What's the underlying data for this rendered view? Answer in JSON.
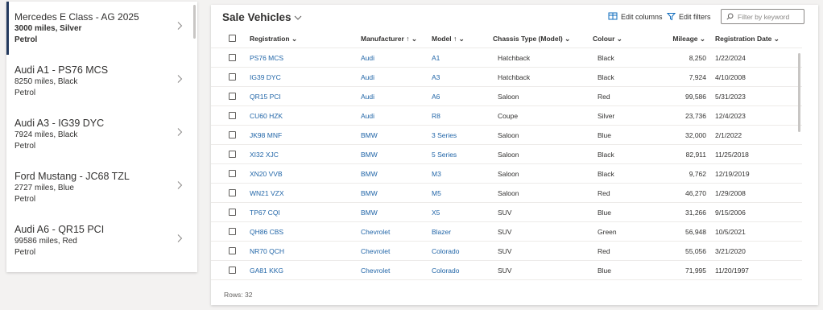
{
  "list": {
    "items": [
      {
        "title": "Mercedes E Class - AG 2025",
        "line1": "3000 miles, Silver",
        "line2": "Petrol",
        "selected": true
      },
      {
        "title": "Audi A1 - PS76 MCS",
        "line1": "8250 miles, Black",
        "line2": "Petrol",
        "selected": false
      },
      {
        "title": "Audi A3 - IG39 DYC",
        "line1": "7924 miles, Black",
        "line2": "Petrol",
        "selected": false
      },
      {
        "title": "Ford Mustang - JC68 TZL",
        "line1": "2727 miles, Blue",
        "line2": "Petrol",
        "selected": false
      },
      {
        "title": "Audi A6 - QR15 PCI",
        "line1": "99586 miles, Red",
        "line2": "Petrol",
        "selected": false
      }
    ]
  },
  "grid": {
    "title": "Sale Vehicles",
    "edit_columns_label": "Edit columns",
    "edit_filters_label": "Edit filters",
    "search_placeholder": "Filter by keyword",
    "columns": {
      "registration": "Registration",
      "manufacturer": "Manufacturer",
      "model": "Model",
      "chassis": "Chassis Type (Model)",
      "colour": "Colour",
      "mileage": "Mileage",
      "registration_date": "Registration Date"
    },
    "rows": [
      {
        "reg": "PS76 MCS",
        "make": "Audi",
        "model": "A1",
        "chassis": "Hatchback",
        "colour": "Black",
        "mileage": "8,250",
        "date": "1/22/2024"
      },
      {
        "reg": "IG39 DYC",
        "make": "Audi",
        "model": "A3",
        "chassis": "Hatchback",
        "colour": "Black",
        "mileage": "7,924",
        "date": "4/10/2008"
      },
      {
        "reg": "QR15 PCI",
        "make": "Audi",
        "model": "A6",
        "chassis": "Saloon",
        "colour": "Red",
        "mileage": "99,586",
        "date": "5/31/2023"
      },
      {
        "reg": "CU60 HZK",
        "make": "Audi",
        "model": "R8",
        "chassis": "Coupe",
        "colour": "Silver",
        "mileage": "23,736",
        "date": "12/4/2023"
      },
      {
        "reg": "JK98 MNF",
        "make": "BMW",
        "model": "3 Series",
        "chassis": "Saloon",
        "colour": "Blue",
        "mileage": "32,000",
        "date": "2/1/2022"
      },
      {
        "reg": "XI32 XJC",
        "make": "BMW",
        "model": "5 Series",
        "chassis": "Saloon",
        "colour": "Black",
        "mileage": "82,911",
        "date": "11/25/2018"
      },
      {
        "reg": "XN20 VVB",
        "make": "BMW",
        "model": "M3",
        "chassis": "Saloon",
        "colour": "Black",
        "mileage": "9,762",
        "date": "12/19/2019"
      },
      {
        "reg": "WN21 VZX",
        "make": "BMW",
        "model": "M5",
        "chassis": "Saloon",
        "colour": "Red",
        "mileage": "46,270",
        "date": "1/29/2008"
      },
      {
        "reg": "TP67 CQI",
        "make": "BMW",
        "model": "X5",
        "chassis": "SUV",
        "colour": "Blue",
        "mileage": "31,266",
        "date": "9/15/2006"
      },
      {
        "reg": "QH86 CBS",
        "make": "Chevrolet",
        "model": "Blazer",
        "chassis": "SUV",
        "colour": "Green",
        "mileage": "56,948",
        "date": "10/5/2021"
      },
      {
        "reg": "NR70 QCH",
        "make": "Chevrolet",
        "model": "Colorado",
        "chassis": "SUV",
        "colour": "Red",
        "mileage": "55,056",
        "date": "3/21/2020"
      },
      {
        "reg": "GA81 KKG",
        "make": "Chevrolet",
        "model": "Colorado",
        "chassis": "SUV",
        "colour": "Blue",
        "mileage": "71,995",
        "date": "11/20/1997"
      }
    ],
    "rows_count": "Rows: 32"
  },
  "colors": {
    "accent_selected": "#243a5e",
    "link": "#2266a8",
    "icon_blue": "#0f6cbd"
  },
  "icons": [
    "chevron-right-icon",
    "chevron-down-icon",
    "sort-up-icon",
    "edit-columns-icon",
    "filter-icon",
    "search-icon"
  ]
}
